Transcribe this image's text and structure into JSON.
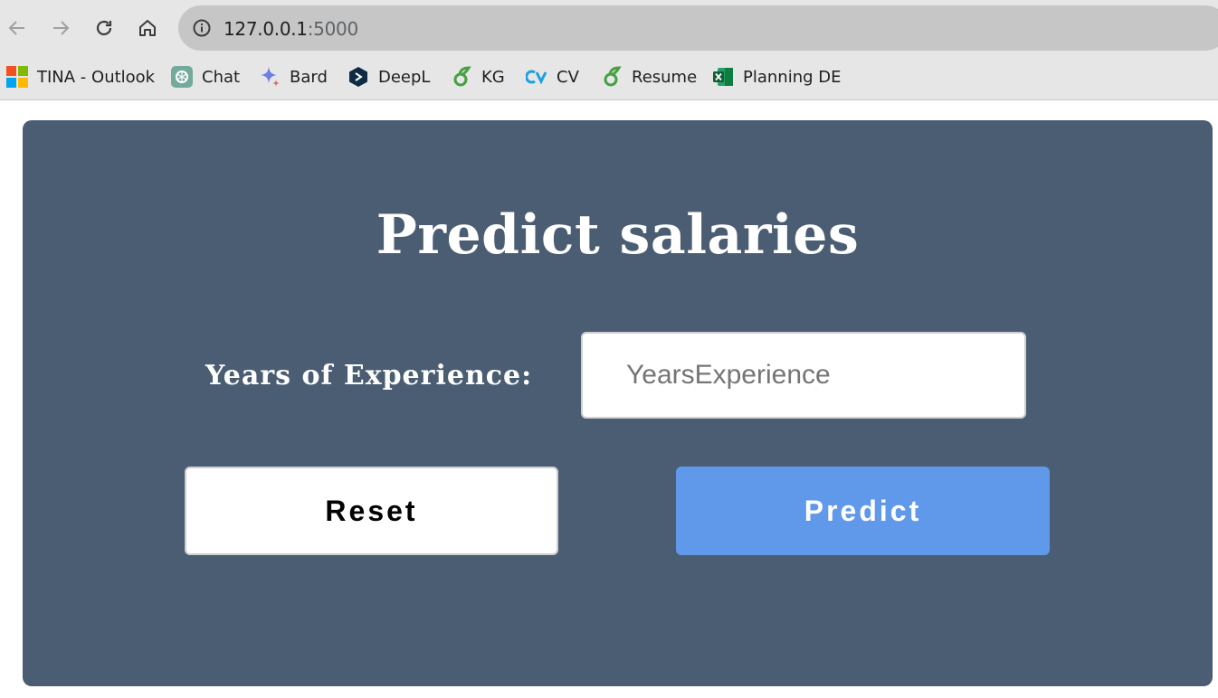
{
  "browser": {
    "url_host": "127.0.0.1",
    "url_port": ":5000",
    "bookmarks": [
      {
        "label": "TINA - Outlook",
        "icon": "microsoft-icon"
      },
      {
        "label": "Chat",
        "icon": "chatgpt-icon"
      },
      {
        "label": "Bard",
        "icon": "bard-icon"
      },
      {
        "label": "DeepL",
        "icon": "deepl-icon"
      },
      {
        "label": "KG",
        "icon": "overleaf-icon"
      },
      {
        "label": "CV",
        "icon": "cv-icon"
      },
      {
        "label": "Resume",
        "icon": "overleaf-icon"
      },
      {
        "label": "Planning DE",
        "icon": "excel-icon"
      }
    ]
  },
  "page": {
    "title": "Predict salaries",
    "experience_label": "Years of Experience:",
    "experience_placeholder": "YearsExperience",
    "reset_label": "Reset",
    "predict_label": "Predict"
  },
  "colors": {
    "card_background": "#4b5d72",
    "predict_button": "#6099e9"
  }
}
